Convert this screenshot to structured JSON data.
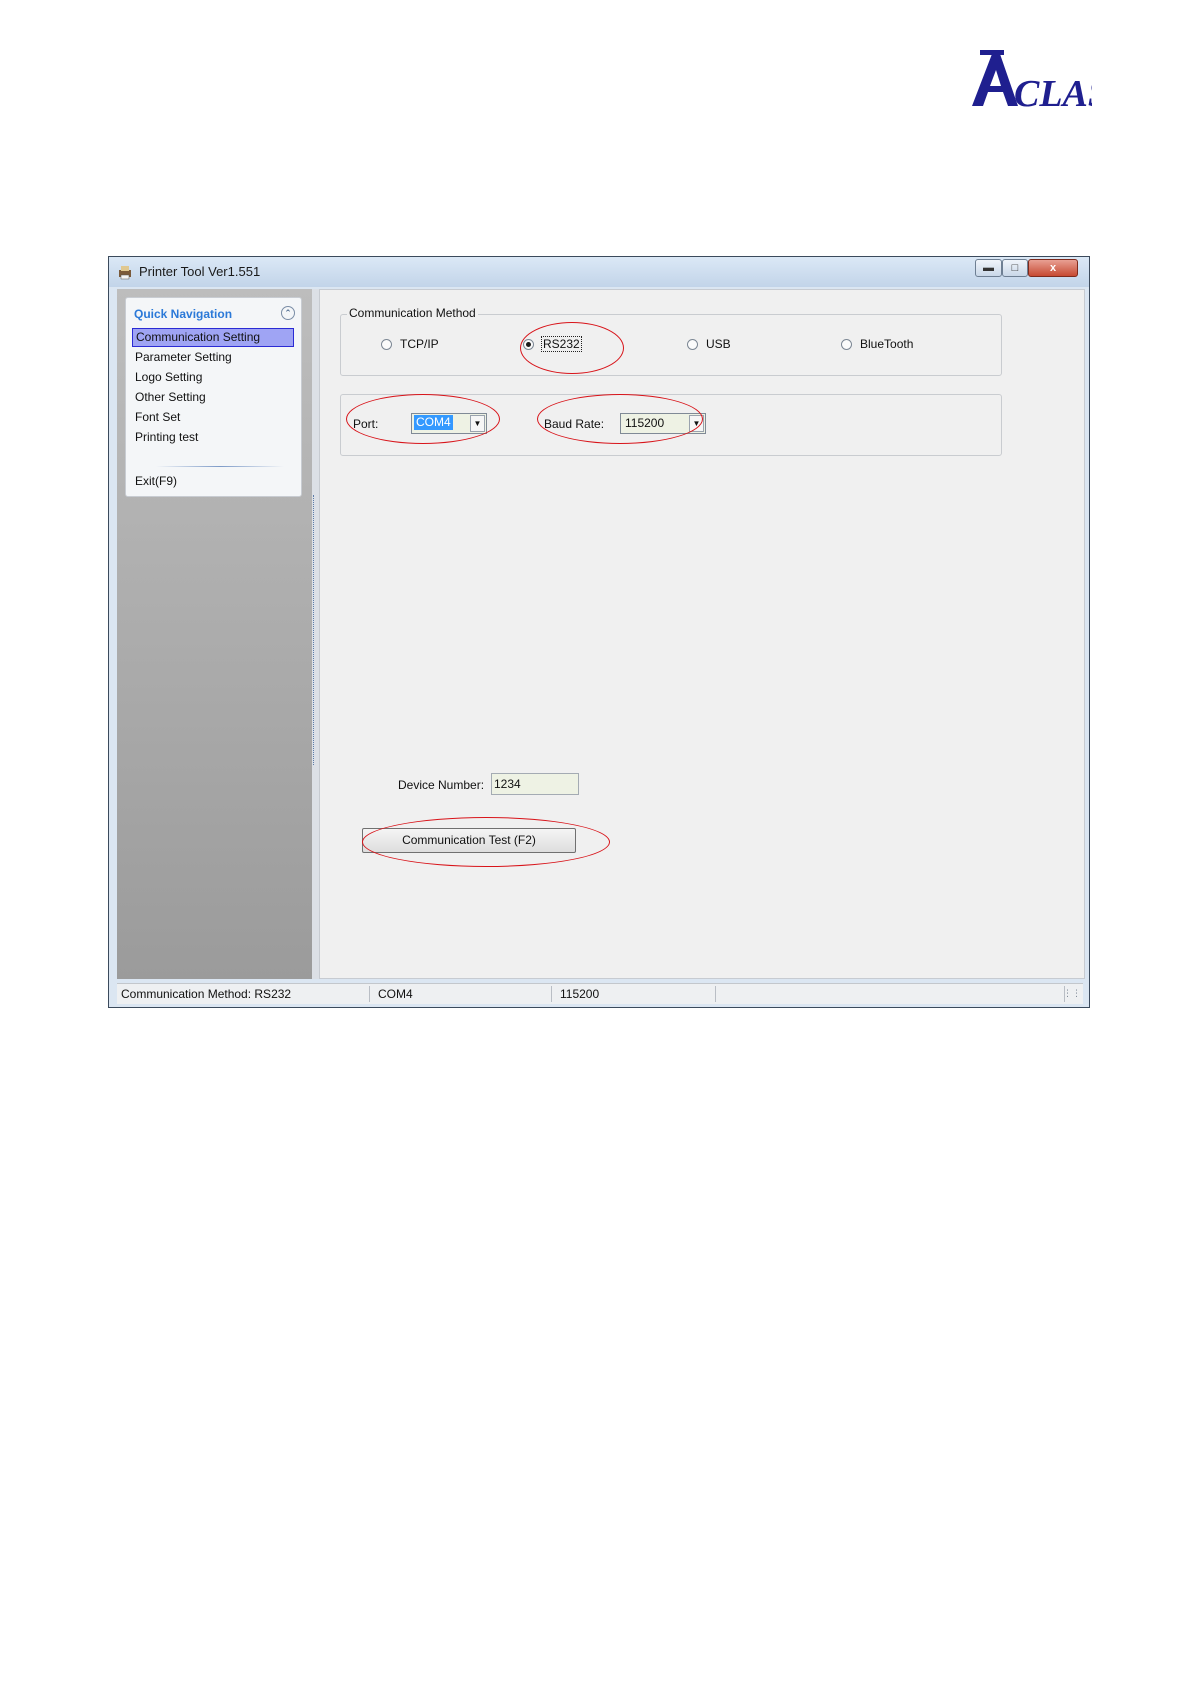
{
  "brand": {
    "logo_text": "ACLAS",
    "logo_color": "#1f1f8f"
  },
  "window": {
    "title": "Printer Tool Ver1.551",
    "icons": {
      "app": "printer-icon",
      "minimize": "minimize-icon",
      "maximize": "maximize-icon",
      "close": "close-icon"
    },
    "close_glyph": "x"
  },
  "sidebar": {
    "header": "Quick Navigation",
    "collapse_icon": "double-chevron-up-icon",
    "items": [
      {
        "label": "Communication Setting",
        "selected": true
      },
      {
        "label": "Parameter Setting"
      },
      {
        "label": "Logo Setting"
      },
      {
        "label": "Other Setting"
      },
      {
        "label": "Font Set"
      },
      {
        "label": "Printing test"
      }
    ],
    "exit_label": "Exit(F9)"
  },
  "communication": {
    "legend": "Communication Method",
    "options": [
      {
        "label": "TCP/IP",
        "checked": false
      },
      {
        "label": "RS232",
        "checked": true
      },
      {
        "label": "USB",
        "checked": false
      },
      {
        "label": "BlueTooth",
        "checked": false
      }
    ]
  },
  "port_settings": {
    "port_label": "Port:",
    "port_value": "COM4",
    "baud_label": "Baud Rate:",
    "baud_value": "115200"
  },
  "device": {
    "label": "Device Number:",
    "value": "1234"
  },
  "test_button": {
    "label": "Communication Test (F2)"
  },
  "status_bar": {
    "method": "Communication Method: RS232",
    "port": "COM4",
    "baud": "115200",
    "extra": ""
  },
  "annotation_color": "#d8141a"
}
